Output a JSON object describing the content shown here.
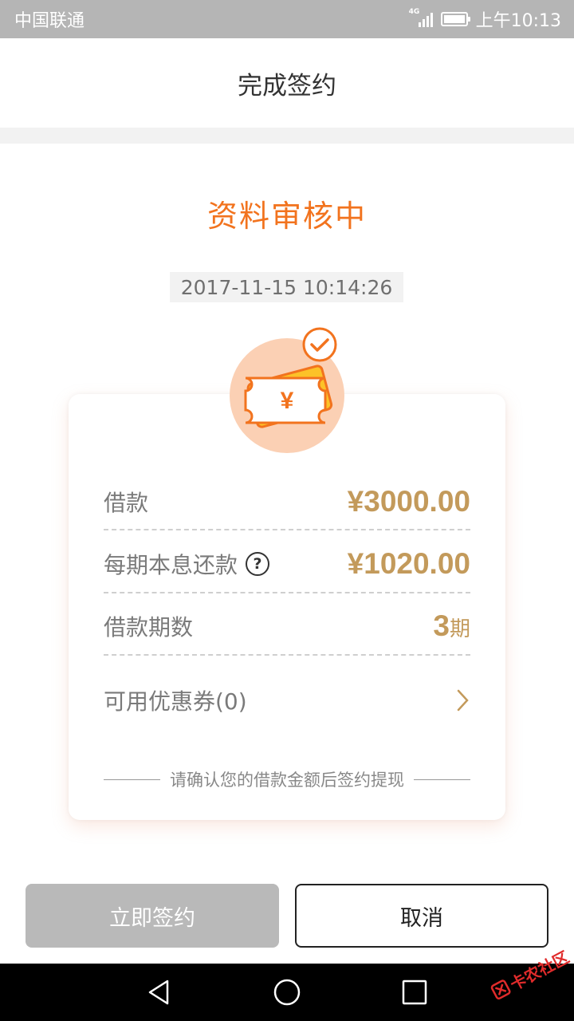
{
  "status_bar": {
    "carrier": "中国联通",
    "network": "4G",
    "time": "上午10:13"
  },
  "header": {
    "title": "完成签约"
  },
  "review": {
    "status_text": "资料审核中",
    "timestamp": "2017-11-15 10:14:26"
  },
  "loan": {
    "amount_label": "借款",
    "amount_value": "¥3000.00",
    "installment_label": "每期本息还款",
    "installment_value": "¥1020.00",
    "terms_label": "借款期数",
    "terms_value": "3",
    "terms_unit": "期",
    "coupon_label": "可用优惠券(0)",
    "note": "请确认您的借款金额后签约提现"
  },
  "actions": {
    "sign_label": "立即签约",
    "cancel_label": "取消"
  },
  "icons": {
    "hero": "money-ticket-icon",
    "check": "check-badge-icon",
    "help": "question-circle-icon",
    "chevron": "chevron-right-icon",
    "nav_back": "triangle-back-icon",
    "nav_home": "circle-home-icon",
    "nav_recent": "square-recent-icon"
  },
  "watermark": {
    "text": "卡农社区"
  },
  "colors": {
    "accent_orange": "#f2731e",
    "gold_value": "#c39a5b",
    "disabled_button": "#b9b9b9"
  }
}
